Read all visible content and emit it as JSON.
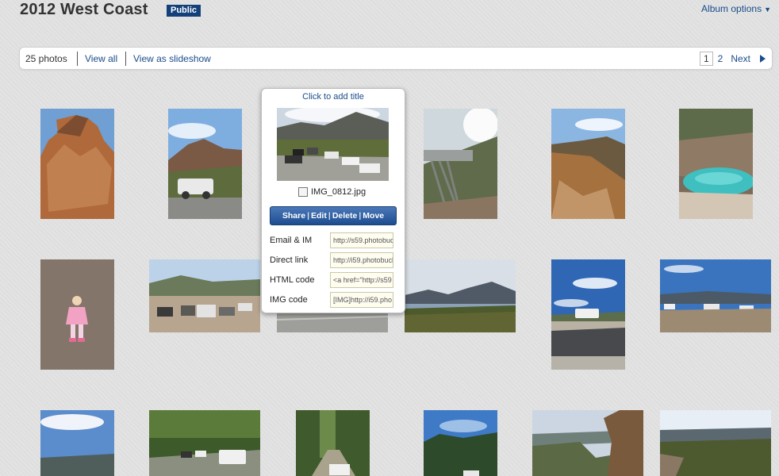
{
  "album": {
    "title": "2012 West Coast",
    "visibility": "Public",
    "options_label": "Album options",
    "options_icon": "triangle-down-icon"
  },
  "toolbar": {
    "count": "25 photos",
    "view_all": "View all",
    "slideshow": "View as slideshow",
    "pager": {
      "current": "1",
      "page2": "2",
      "next": "Next",
      "next_icon": "triangle-right-icon"
    }
  },
  "card": {
    "add_title": "Click to add title",
    "filename": "IMG_0812.jpg",
    "actions": [
      "Share",
      "Edit",
      "Delete",
      "Move"
    ],
    "links": [
      {
        "label": "Email & IM",
        "value": "http://s59.photobucket"
      },
      {
        "label": "Direct link",
        "value": "http://i59.photobucket"
      },
      {
        "label": "HTML code",
        "value": "<a href=\"http://s59"
      },
      {
        "label": "IMG code",
        "value": "[IMG]http://i59.pho"
      }
    ]
  },
  "photos": [
    {
      "name": "photo-rock-cliff"
    },
    {
      "name": "photo-white-ute-mountains"
    },
    {
      "name": "photo-cars-parked-valley"
    },
    {
      "name": "photo-viewing-platform"
    },
    {
      "name": "photo-mountain-slope"
    },
    {
      "name": "photo-green-lake-pit"
    },
    {
      "name": "photo-child-pink-jacket"
    },
    {
      "name": "photo-cars-on-lot"
    },
    {
      "name": "photo-road-gravel"
    },
    {
      "name": "photo-lake-mountains"
    },
    {
      "name": "photo-car-road-clouds"
    },
    {
      "name": "photo-cars-roadside-lake"
    },
    {
      "name": "photo-sky-hills"
    },
    {
      "name": "photo-forest-cars"
    },
    {
      "name": "photo-forest-road-car"
    },
    {
      "name": "photo-bush-trees"
    },
    {
      "name": "photo-gorge-view"
    },
    {
      "name": "photo-valley-view"
    }
  ]
}
